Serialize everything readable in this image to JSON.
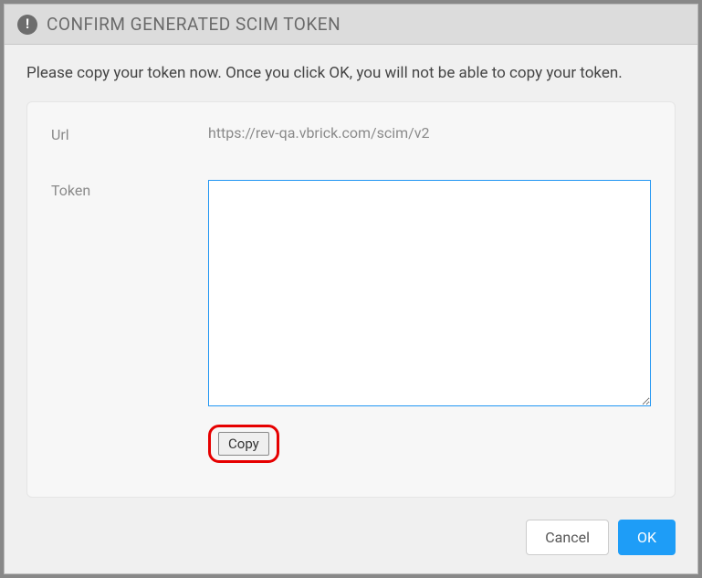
{
  "header": {
    "title": "CONFIRM GENERATED SCIM TOKEN"
  },
  "body": {
    "instruction": "Please copy your token now. Once you click OK, you will not be able to copy your token.",
    "url_label": "Url",
    "url_value": "https://rev-qa.vbrick.com/scim/v2",
    "token_label": "Token",
    "token_value": "",
    "copy_label": "Copy"
  },
  "footer": {
    "cancel_label": "Cancel",
    "ok_label": "OK"
  }
}
